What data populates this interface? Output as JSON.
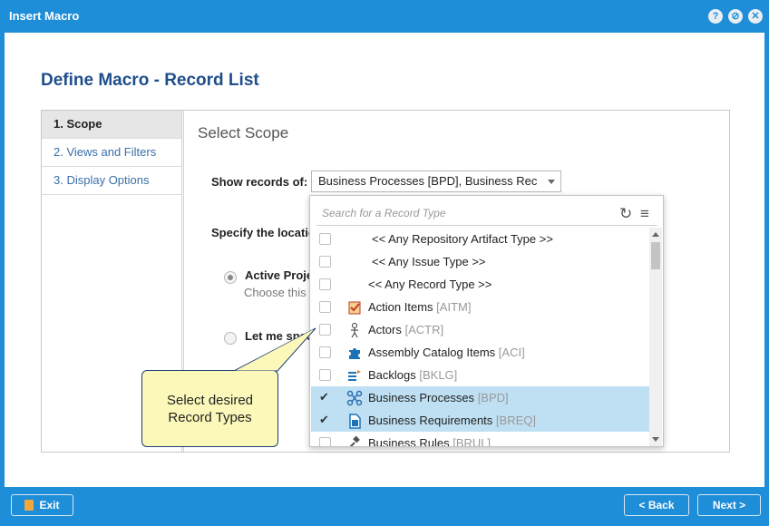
{
  "window": {
    "title": "Insert Macro"
  },
  "header": {
    "title": "Define Macro - Record List"
  },
  "steps": [
    {
      "label": "1. Scope"
    },
    {
      "label": "2. Views and Filters"
    },
    {
      "label": "3. Display Options"
    }
  ],
  "scope": {
    "section_title": "Select Scope",
    "show_records_label": "Show records of:",
    "show_records_value": "Business Processes [BPD], Business Rec",
    "location_label": "Specify the locatio",
    "radio_active_label": "Active Proje",
    "radio_active_desc": "Choose this o",
    "radio_specify_label": "Let me spec"
  },
  "dropdown": {
    "search_placeholder": "Search for a Record Type",
    "items": [
      {
        "label": "<< Any Repository Artifact Type >>",
        "code": "",
        "checked": false,
        "icon": "none"
      },
      {
        "label": "<< Any Issue Type >>",
        "code": "",
        "checked": false,
        "icon": "none"
      },
      {
        "label": "<< Any Record Type >>",
        "code": "",
        "checked": false,
        "icon": "none"
      },
      {
        "label": "Action Items",
        "code": "[AITM]",
        "checked": false,
        "icon": "action-items-icon"
      },
      {
        "label": "Actors",
        "code": "[ACTR]",
        "checked": false,
        "icon": "actor-icon"
      },
      {
        "label": "Assembly Catalog Items",
        "code": "[ACI]",
        "checked": false,
        "icon": "puzzle-icon"
      },
      {
        "label": "Backlogs",
        "code": "[BKLG]",
        "checked": false,
        "icon": "backlog-icon"
      },
      {
        "label": "Business Processes",
        "code": "[BPD]",
        "checked": true,
        "icon": "process-icon"
      },
      {
        "label": "Business Requirements",
        "code": "[BREQ]",
        "checked": true,
        "icon": "document-icon"
      },
      {
        "label": "Business Rules",
        "code": "[BRUL]",
        "checked": false,
        "icon": "gavel-icon"
      }
    ]
  },
  "callout": {
    "line1": "Select desired",
    "line2": "Record Types"
  },
  "footer": {
    "exit_label": "Exit",
    "back_label": "< Back",
    "next_label": "Next >"
  }
}
